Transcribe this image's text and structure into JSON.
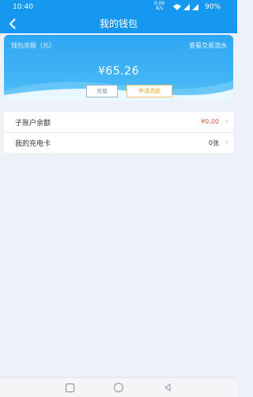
{
  "status_bar": {
    "time": "10:40",
    "speed_value": "0.00",
    "speed_unit": "K/s",
    "battery": "90%",
    "signal_icon": "signal-icon",
    "wifi_icon": "wifi-icon"
  },
  "header": {
    "title": "我的钱包",
    "back_icon": "back-arrow-icon"
  },
  "wallet_card": {
    "balance_label": "钱包余额（元）",
    "history_link": "查看交易流水",
    "amount": "¥65.26",
    "recharge_button": "充值",
    "refund_button": "申请退款"
  },
  "list": {
    "items": [
      {
        "label": "子账户余额",
        "value": "¥0.00"
      },
      {
        "label": "我的充电卡",
        "value": "0张"
      }
    ]
  },
  "colors": {
    "primary": "#1697f0",
    "accent_red": "#e5544c",
    "refund_gold": "#e0a232"
  }
}
